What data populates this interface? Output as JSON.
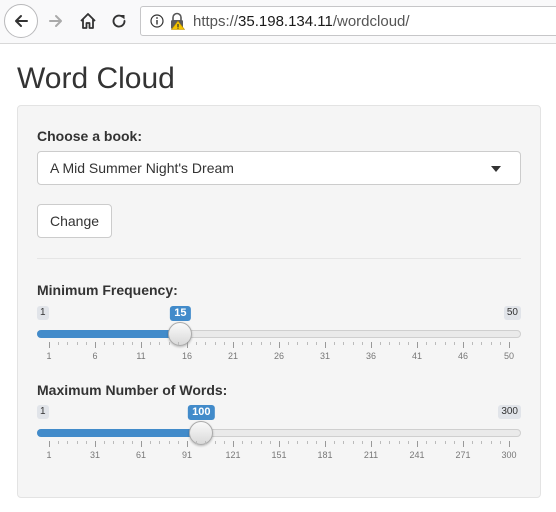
{
  "browser": {
    "url_scheme": "https://",
    "url_host": "35.198.134.11",
    "url_path": "/wordcloud/"
  },
  "page": {
    "title": "Word Cloud"
  },
  "form": {
    "book_label": "Choose a book:",
    "book_selected": "A Mid Summer Night's Dream",
    "change_label": "Change",
    "min_freq": {
      "label": "Minimum Frequency:",
      "min": 1,
      "max": 50,
      "value": 15,
      "min_text": "1",
      "max_text": "50",
      "value_text": "15",
      "tick_labels": [
        "1",
        "6",
        "11",
        "16",
        "21",
        "26",
        "31",
        "36",
        "41",
        "46",
        "50"
      ]
    },
    "max_words": {
      "label": "Maximum Number of Words:",
      "min": 1,
      "max": 300,
      "value": 100,
      "min_text": "1",
      "max_text": "300",
      "value_text": "100",
      "tick_labels": [
        "1",
        "31",
        "61",
        "91",
        "121",
        "151",
        "181",
        "211",
        "241",
        "271",
        "300"
      ]
    }
  },
  "colors": {
    "accent": "#428bca",
    "well_bg": "#f5f5f5"
  }
}
